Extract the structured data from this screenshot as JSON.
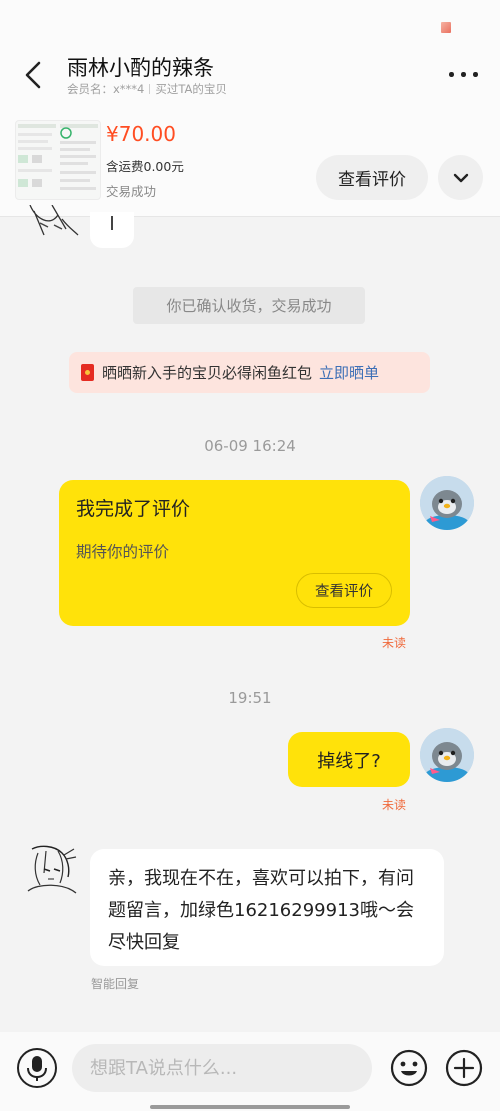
{
  "header": {
    "title": "雨林小酌的辣条",
    "member_label": "会员名：x***4",
    "bought_label": "买过TA的宝贝",
    "back_icon": "chevron-left-icon",
    "more_icon": "more-dots-icon"
  },
  "product": {
    "price": "¥70.00",
    "shipping": "含运费0.00元",
    "status": "交易成功",
    "review_button": "查看评价",
    "expand_icon": "chevron-down-icon"
  },
  "messages": {
    "confirm_note": "你已确认收货，交易成功",
    "promo_text": "晒晒新入手的宝贝必得闲鱼红包",
    "promo_link": "立即晒单",
    "time1": "06-09 16:24",
    "review_card": {
      "title": "我完成了评价",
      "desc": "期待你的评价",
      "button": "查看评价"
    },
    "unread_label": "未读",
    "time2": "19:51",
    "my_text": "掉线了?",
    "seller_text": "亲，我现在不在，喜欢可以拍下，有问题留言，加绿色16216299913哦～会尽快回复",
    "auto_reply_label": "智能回复"
  },
  "input_bar": {
    "placeholder": "想跟TA说点什么...",
    "value": "",
    "voice_icon": "microphone-icon",
    "emoji_icon": "emoji-icon",
    "plus_icon": "plus-icon"
  },
  "colors": {
    "my_bubble": "#ffe20a",
    "price": "#ff4d22",
    "link": "#3d6fb6",
    "unread": "#f06a3c"
  }
}
